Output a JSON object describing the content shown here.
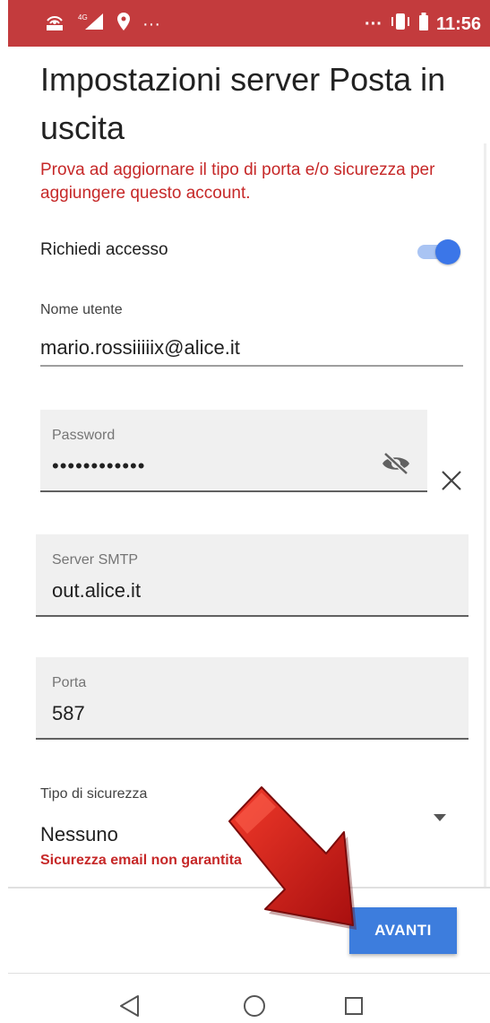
{
  "status_bar": {
    "left_icons": [
      "hotspot-icon",
      "signal-4g-icon",
      "location-icon",
      "more-icon"
    ],
    "time": "11:56",
    "network": "4G"
  },
  "page": {
    "title": "Impostazioni server Posta in uscita",
    "error_message": "Prova ad aggiornare il tipo di porta e/o sicurezza per aggiungere questo account."
  },
  "require_access": {
    "label": "Richiedi accesso",
    "enabled": true
  },
  "username": {
    "label": "Nome utente",
    "value": "mario.rossiiiiix@alice.it"
  },
  "password": {
    "label": "Password",
    "value": "••••••••••••"
  },
  "smtp_server": {
    "label": "Server SMTP",
    "value": "out.alice.it"
  },
  "port": {
    "label": "Porta",
    "value": "587"
  },
  "security": {
    "label": "Tipo di sicurezza",
    "value": "Nessuno",
    "warning": "Sicurezza email non garantita"
  },
  "actions": {
    "next_label": "AVANTI"
  },
  "colors": {
    "status_bar": "#c33b3d",
    "accent": "#3b76e8",
    "button": "#3d7ddd",
    "error": "#c62828",
    "annotation_arrow": "#d01818"
  }
}
